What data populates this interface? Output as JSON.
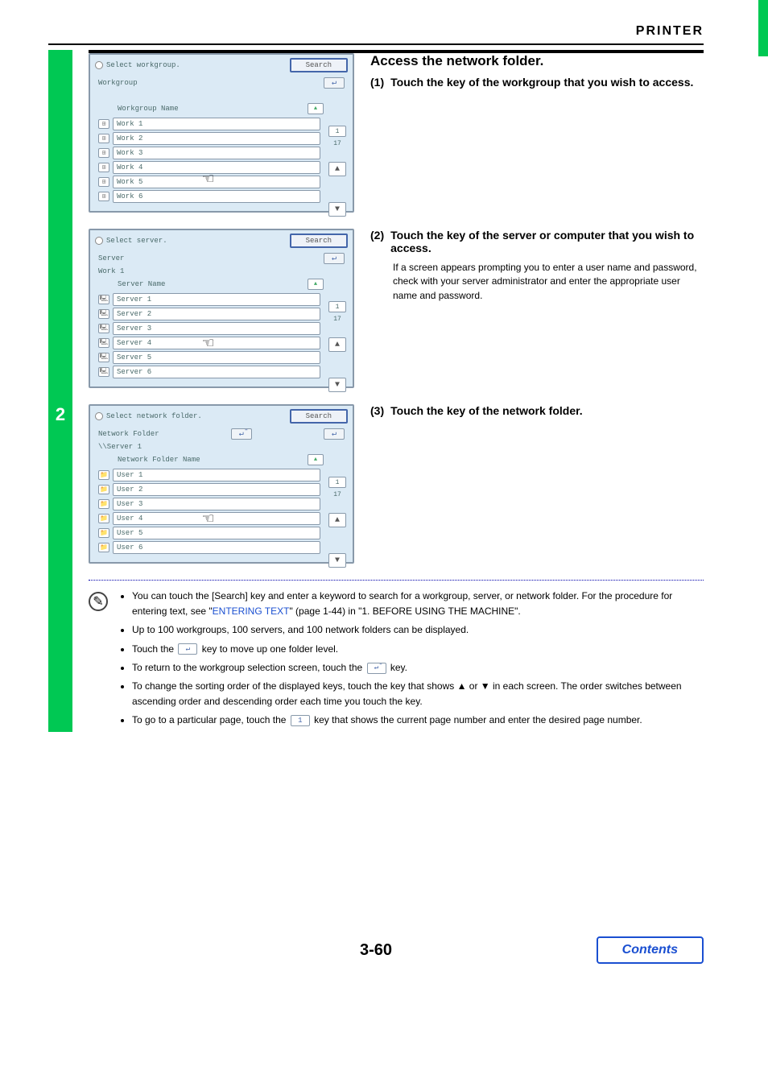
{
  "header": {
    "title": "PRINTER"
  },
  "leftbar": {
    "section_number": "2"
  },
  "main_heading": "Access the network folder.",
  "steps": [
    {
      "num": "(1)",
      "label": "Touch the key of the workgroup that you wish to access.",
      "body": ""
    },
    {
      "num": "(2)",
      "label": "Touch the key of the server or computer that you wish to access.",
      "body": "If a screen appears prompting you to enter a user name and password, check with your server administrator and enter the appropriate user name and password."
    },
    {
      "num": "(3)",
      "label": "Touch the key of the network folder.",
      "body": ""
    }
  ],
  "panels": [
    {
      "title": "Select workgroup.",
      "search": "Search",
      "crumbs": [
        "Workgroup"
      ],
      "header_label": "Workgroup Name",
      "page_current": "1",
      "page_total": "17",
      "rows": [
        "Work 1",
        "Work 2",
        "Work 3",
        "Work 4",
        "Work 5",
        "Work 6"
      ],
      "icon_kind": "net",
      "up_buttons": 1
    },
    {
      "title": "Select server.",
      "search": "Search",
      "crumbs": [
        "Server",
        "Work 1"
      ],
      "header_label": "Server Name",
      "page_current": "1",
      "page_total": "17",
      "rows": [
        "Server 1",
        "Server 2",
        "Server 3",
        "Server 4",
        "Server 5",
        "Server 6"
      ],
      "icon_kind": "pc",
      "up_buttons": 1
    },
    {
      "title": "Select network folder.",
      "search": "Search",
      "crumbs": [
        "Network Folder",
        "\\\\Server 1"
      ],
      "header_label": "Network Folder Name",
      "page_current": "1",
      "page_total": "17",
      "rows": [
        "User 1",
        "User 2",
        "User 3",
        "User 4",
        "User 5",
        "User 6"
      ],
      "icon_kind": "folder",
      "up_buttons": 2
    }
  ],
  "notes": {
    "items": [
      {
        "pre": "You can touch the [Search] key and enter a keyword to search for a workgroup, server, or network folder. For the procedure for entering text, see \"",
        "link": "ENTERING TEXT",
        "post": "\" (page 1-44) in \"1. BEFORE USING THE MACHINE\"."
      },
      {
        "plain": "Up to 100 workgroups, 100 servers, and 100 network folders can be displayed."
      },
      {
        "pre": "Touch the ",
        "btn": "↵",
        "post": " key to move up one folder level."
      },
      {
        "pre": "To return to the workgroup selection screen, touch the ",
        "btn": "↵̄",
        "post": " key."
      },
      {
        "plain": "To change the sorting order of the displayed keys, touch the key that shows ▲ or ▼ in each screen. The order switches between ascending order and descending order each time you touch the key."
      },
      {
        "pre": "To go to a particular page, touch the ",
        "btn": "1",
        "post": " key that shows the current page number and enter the desired page number."
      }
    ]
  },
  "footer": {
    "page": "3-60",
    "contents": "Contents"
  }
}
